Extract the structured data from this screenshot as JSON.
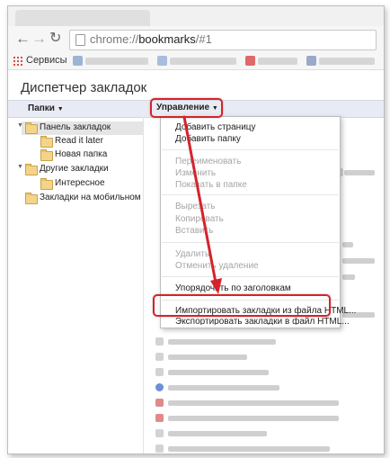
{
  "browser": {
    "url_prefix": "chrome://",
    "url_main": "bookmarks",
    "url_suffix": "/#1",
    "bookmarks_bar": {
      "apps_label": "Сервисы"
    }
  },
  "manager": {
    "title": "Диспетчер закладок",
    "folders_label": "Папки",
    "manage_label": "Управление"
  },
  "tree": [
    {
      "label": "Панель закладок",
      "selected": true
    },
    {
      "label": "Read it later"
    },
    {
      "label": "Новая папка"
    },
    {
      "label": "Другие закладки"
    },
    {
      "label": "Интересное"
    },
    {
      "label": "Закладки на мобильном"
    }
  ],
  "menu": {
    "items": [
      {
        "label": "Добавить страницу",
        "enabled": true
      },
      {
        "label": "Добавить папку",
        "enabled": true
      },
      {
        "label": "Переименовать",
        "enabled": false
      },
      {
        "label": "Изменить",
        "enabled": false
      },
      {
        "label": "Показать в папке",
        "enabled": false
      },
      {
        "label": "Вырезать",
        "enabled": false
      },
      {
        "label": "Копировать",
        "enabled": false
      },
      {
        "label": "Вставить",
        "enabled": false
      },
      {
        "label": "Удалить",
        "enabled": false
      },
      {
        "label": "Отменить удаление",
        "enabled": false
      },
      {
        "label": "Упорядочить по заголовкам",
        "enabled": true
      },
      {
        "label": "Импортировать закладки из файла HTML...",
        "enabled": true
      },
      {
        "label": "Экспортировать закладки в файл HTML...",
        "enabled": true
      }
    ]
  },
  "colors": {
    "annotation_red": "#d5232b",
    "folder_yellow": "#f3d48a"
  }
}
